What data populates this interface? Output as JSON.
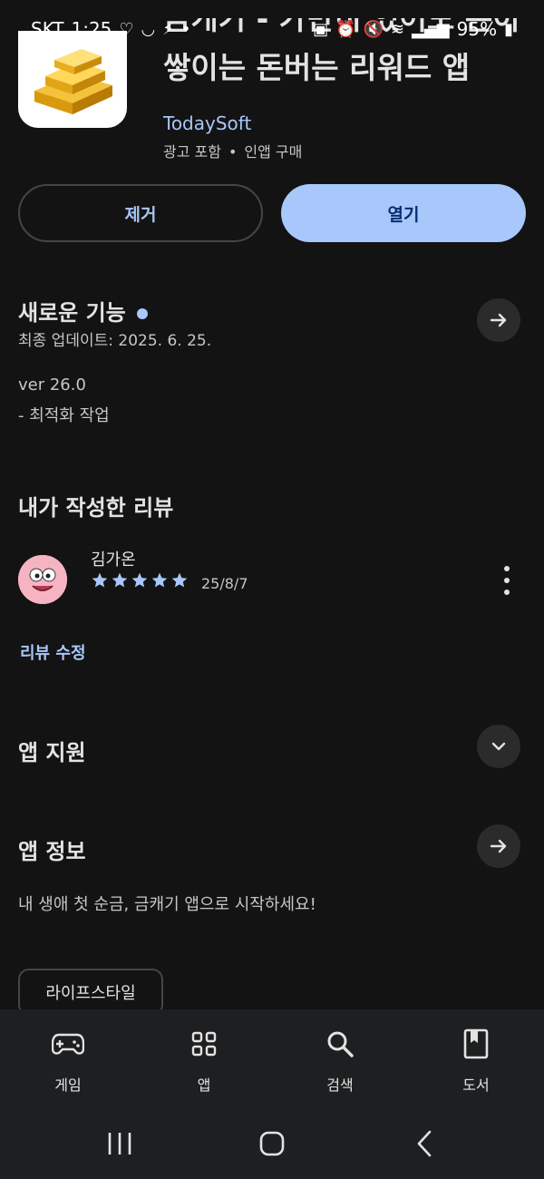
{
  "status_bar": {
    "carrier": "SKT",
    "time": "1:25",
    "battery": "95%"
  },
  "app": {
    "title_line1": "금캐기 - 가만히 있어도 돈이",
    "title_line2": "쌓이는 돈버는 리워드 앱",
    "developer": "TodaySoft",
    "meta_ads": "광고 포함",
    "meta_separator": "•",
    "meta_iap": "인앱 구매"
  },
  "actions": {
    "uninstall_label": "제거",
    "open_label": "열기"
  },
  "whats_new": {
    "title": "새로운 기능",
    "updated": "최종 업데이트: 2025. 6. 25.",
    "version": "ver 26.0",
    "notes": "- 최적화 작업"
  },
  "my_review": {
    "title": "내가 작성한 리뷰",
    "reviewer": "김가온",
    "rating": 5,
    "date": "25/8/7",
    "edit_label": "리뷰 수정"
  },
  "app_support": {
    "title": "앱 지원"
  },
  "app_info": {
    "title": "앱 정보",
    "description": "내 생애 첫 순금, 금캐기 앱으로 시작하세요!",
    "category_chip": "라이프스타일"
  },
  "bottom_nav": {
    "items": [
      {
        "label": "게임",
        "icon": "gamepad-icon"
      },
      {
        "label": "앱",
        "icon": "apps-grid-icon"
      },
      {
        "label": "검색",
        "icon": "search-icon"
      },
      {
        "label": "도서",
        "icon": "book-icon"
      }
    ]
  },
  "colors": {
    "background": "#131313",
    "accent": "#a8c7fa",
    "text": "#e3e3e3",
    "muted": "#c4c7c5"
  }
}
